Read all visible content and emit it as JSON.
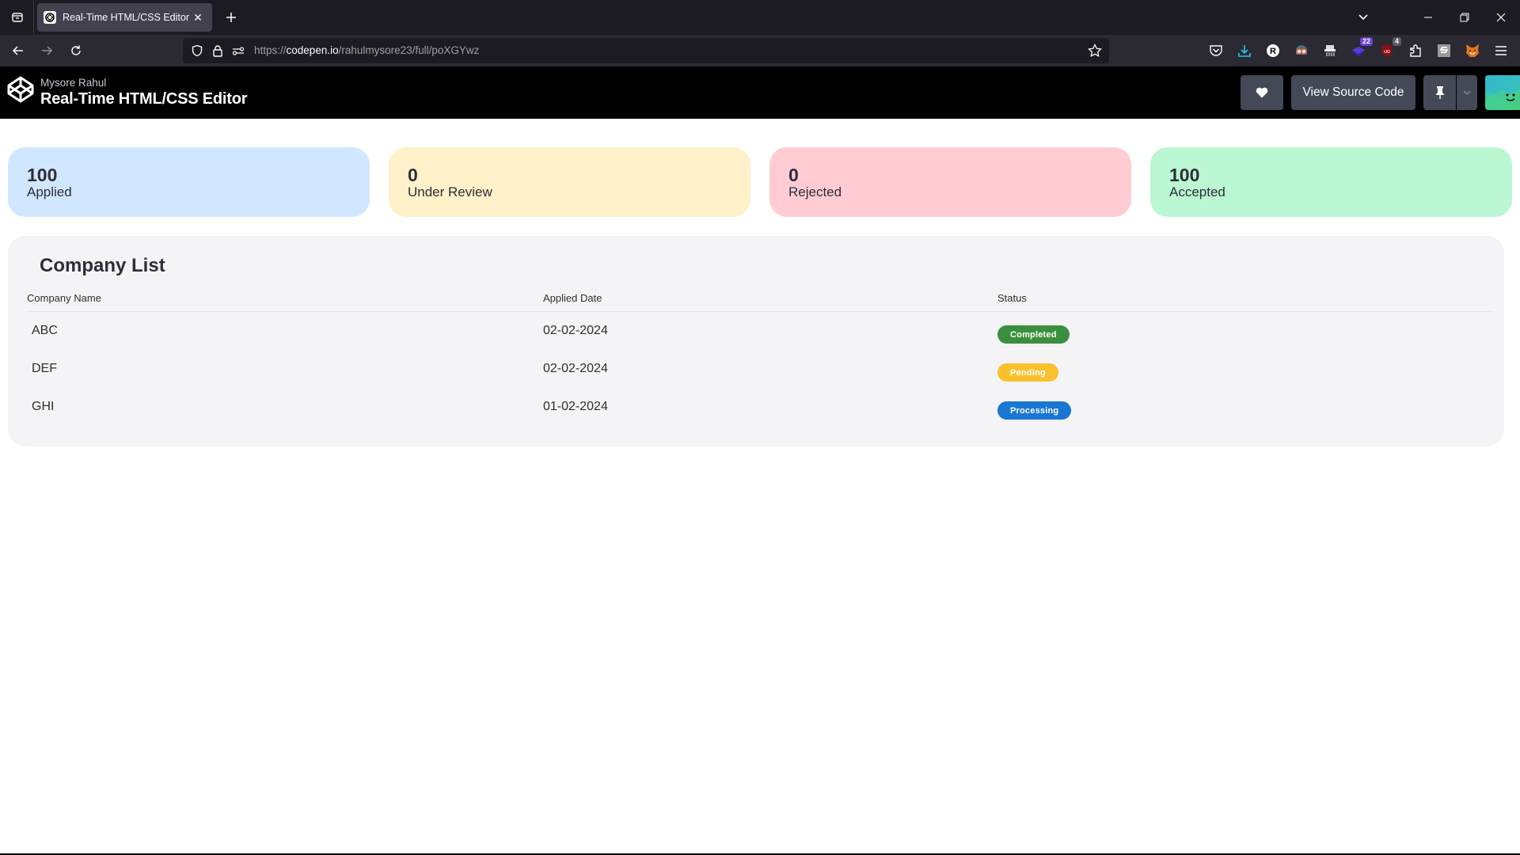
{
  "browser": {
    "tab_title": "Real-Time HTML/CSS Editor",
    "url_prefix": "https://",
    "url_host": "codepen.io",
    "url_path": "/rahulmysore23/full/poXGYwz",
    "extensions": [
      {
        "name": "pocket-icon"
      },
      {
        "name": "download-icon"
      },
      {
        "name": "r-extension-icon"
      },
      {
        "name": "goggles-extension-icon"
      },
      {
        "name": "shredder-extension-icon"
      },
      {
        "name": "stack-extension-icon",
        "badge": "22",
        "badge_color": "#6b3fd1"
      },
      {
        "name": "ublock-icon",
        "badge": "4",
        "badge_color": "#5c5c66"
      },
      {
        "name": "extensions-puzzle-icon"
      },
      {
        "name": "s-extension-icon"
      },
      {
        "name": "metamask-fox-icon"
      }
    ]
  },
  "header": {
    "author": "Mysore Rahul",
    "title": "Real-Time HTML/CSS Editor",
    "view_source_label": "View Source Code"
  },
  "stats": [
    {
      "value": "100",
      "label": "Applied",
      "color": "#d1e7ff"
    },
    {
      "value": "0",
      "label": "Under Review",
      "color": "#fff1c9"
    },
    {
      "value": "0",
      "label": "Rejected",
      "color": "#ffccd3"
    },
    {
      "value": "100",
      "label": "Accepted",
      "color": "#bbf7d2"
    }
  ],
  "company_list": {
    "title": "Company List",
    "columns": [
      "Company Name",
      "Applied Date",
      "Status"
    ],
    "rows": [
      {
        "company": "ABC",
        "date": "02-02-2024",
        "status": "Completed",
        "status_color": "#3a8f3e"
      },
      {
        "company": "DEF",
        "date": "02-02-2024",
        "status": "Pending",
        "status_color": "#fbc02d"
      },
      {
        "company": "GHI",
        "date": "01-02-2024",
        "status": "Processing",
        "status_color": "#1976d2"
      }
    ]
  }
}
